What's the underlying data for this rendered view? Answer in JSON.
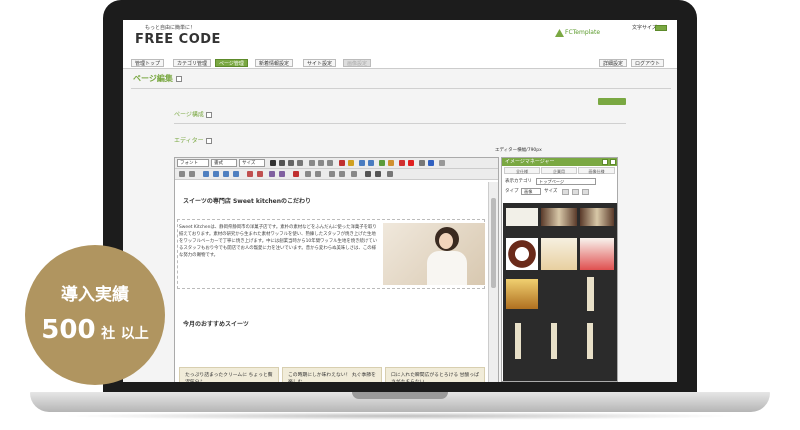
{
  "header": {
    "tagline": "もっと自由に簡単に！",
    "logo": "FREE CODE",
    "fc_logo": "FCTemplate",
    "font_size_label": "文字サイズ"
  },
  "nav": {
    "items": [
      {
        "label": "管理トップ",
        "state": "normal"
      },
      {
        "label": "カテゴリ管理",
        "state": "normal"
      },
      {
        "label": "ページ管理",
        "state": "active"
      },
      {
        "label": "新着情報設定",
        "state": "normal"
      },
      {
        "label": "サイト設定",
        "state": "normal"
      },
      {
        "label": "画像設定",
        "state": "disabled"
      }
    ],
    "right": [
      {
        "label": "詳細設定"
      },
      {
        "label": "ログアウト"
      }
    ]
  },
  "page": {
    "title": "ページ編集",
    "section_structure": "ページ構成",
    "section_editor": "エディター",
    "editor_width": "エディター横幅/790px"
  },
  "toolbar": {
    "font": "フォント",
    "style": "書式",
    "size": "サイズ"
  },
  "document": {
    "heading": "スイーツの専門店 Sweet kitchenのこだわり",
    "body": "Sweet Kitchenは、静岡県静岡市の洋菓子店です。素朴の素材などをふんだんに使った洋菓子を取り揃えております。素材の研究から生まれた素材ワッフルを使い、熟練したスタッフが焼き上げた生地をワッフルベーカーで丁寧に焼き上げます。中には創業当時から10年間ワッフル生地を焼き続けているスタッフもおり今でも開店でお人の寵愛に力を注いでいます。昔から変わらぬ美味しさは、この様な努力の賜物です。",
    "subheading": "今月のおすすめスイーツ",
    "cards": [
      "たっぷり詰まったクリームに ちょっと贅沢気分♪",
      "この時期にしか味わえない！ 丸ぐ季節を楽しむ",
      "口に入れた瞬間広がるとろける 甘酸っぱさがたまらない"
    ]
  },
  "image_manager": {
    "title": "イメージマネージャー",
    "tabs": [
      "全仕様",
      "企業用",
      "画像仕様"
    ],
    "display_category_label": "表示カテゴリ",
    "display_category_value": "トップページ",
    "type_label": "タイプ",
    "type_value": "画像",
    "size_label": "サイズ"
  },
  "badge": {
    "line1": "導入実績",
    "number": "500",
    "unit": "社",
    "suffix": "以上"
  }
}
